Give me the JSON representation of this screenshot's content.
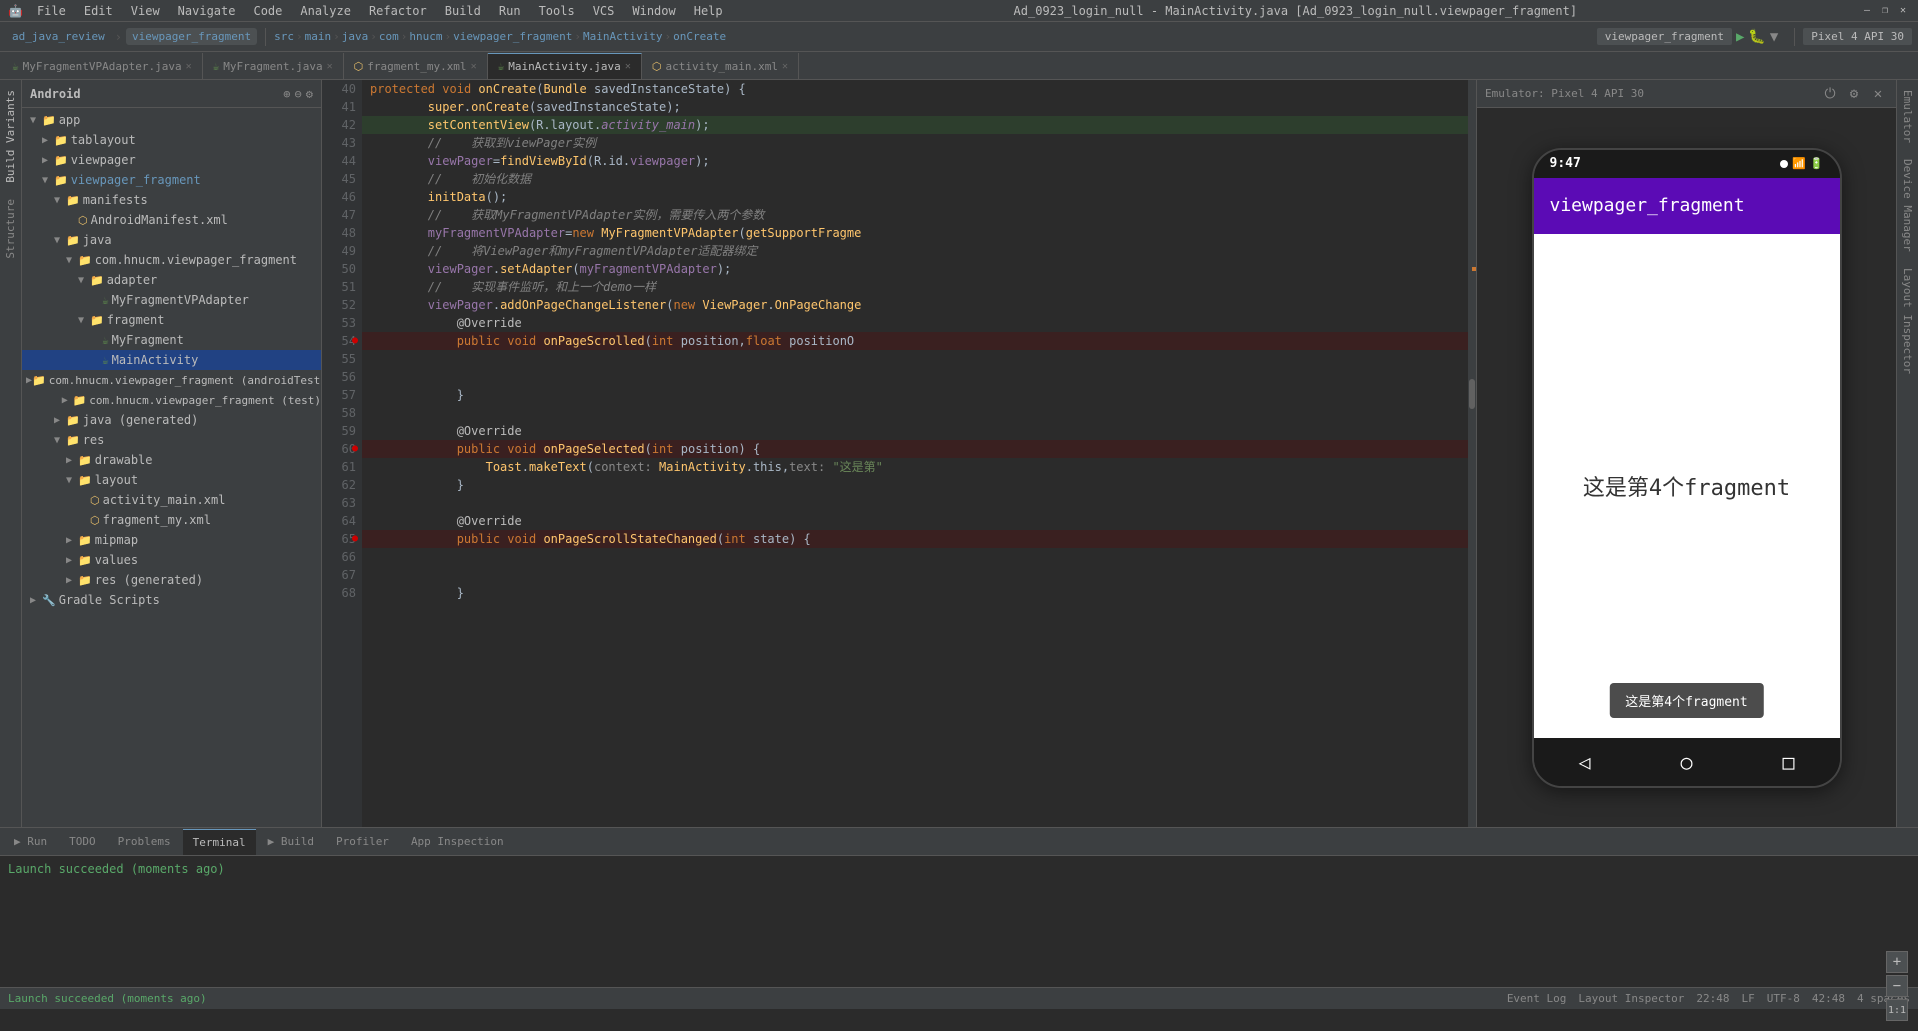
{
  "window": {
    "title": "Ad_0923_login_null - MainActivity.java [Ad_0923_login_null.viewpager_fragment]",
    "controls": [
      "—",
      "❐",
      "✕"
    ]
  },
  "menu": {
    "items": [
      "File",
      "Edit",
      "View",
      "Navigate",
      "Code",
      "Analyze",
      "Refactor",
      "Build",
      "Run",
      "Tools",
      "VCS",
      "Window",
      "Help"
    ]
  },
  "toolbar": {
    "project_name": "ad_java_review",
    "module": "viewpager_fragment",
    "src_path": "src > main > java > com > hnucm > viewpager_fragment",
    "breadcrumb": [
      "MainActivity",
      "onCreate"
    ],
    "run_config": "viewpager_fragment",
    "device": "Pixel 4 API 30"
  },
  "file_tabs": [
    {
      "name": "MyFragmentVPAdapter.java",
      "active": false
    },
    {
      "name": "MyFragment.java",
      "active": false
    },
    {
      "name": "fragment_my.xml",
      "active": false
    },
    {
      "name": "MainActivity.java",
      "active": true
    },
    {
      "name": "activity_main.xml",
      "active": false
    }
  ],
  "sidebar": {
    "title": "Android",
    "items": [
      {
        "level": 0,
        "type": "folder",
        "name": "app",
        "expanded": true
      },
      {
        "level": 1,
        "type": "folder",
        "name": "tablayout",
        "expanded": false
      },
      {
        "level": 1,
        "type": "folder",
        "name": "viewpager",
        "expanded": false
      },
      {
        "level": 1,
        "type": "folder",
        "name": "viewpager_fragment",
        "expanded": true,
        "highlighted": true
      },
      {
        "level": 2,
        "type": "folder",
        "name": "manifests",
        "expanded": true
      },
      {
        "level": 3,
        "type": "xml",
        "name": "AndroidManifest.xml"
      },
      {
        "level": 2,
        "type": "folder",
        "name": "java",
        "expanded": true
      },
      {
        "level": 3,
        "type": "folder",
        "name": "com.hnucm.viewpager_fragment",
        "expanded": true
      },
      {
        "level": 4,
        "type": "folder",
        "name": "adapter",
        "expanded": true
      },
      {
        "level": 5,
        "type": "java",
        "name": "MyFragmentVPAdapter"
      },
      {
        "level": 4,
        "type": "folder",
        "name": "fragment",
        "expanded": true
      },
      {
        "level": 5,
        "type": "java",
        "name": "MyFragment"
      },
      {
        "level": 5,
        "type": "java",
        "name": "MainActivity",
        "selected": true
      },
      {
        "level": 3,
        "type": "folder",
        "name": "com.hnucm.viewpager_fragment (androidTest)",
        "expanded": false
      },
      {
        "level": 3,
        "type": "folder",
        "name": "com.hnucm.viewpager_fragment (test)",
        "expanded": false
      },
      {
        "level": 2,
        "type": "folder",
        "name": "java (generated)",
        "expanded": false
      },
      {
        "level": 2,
        "type": "folder",
        "name": "res",
        "expanded": true
      },
      {
        "level": 3,
        "type": "folder",
        "name": "drawable",
        "expanded": false
      },
      {
        "level": 3,
        "type": "folder",
        "name": "layout",
        "expanded": true
      },
      {
        "level": 4,
        "type": "xml",
        "name": "activity_main.xml"
      },
      {
        "level": 4,
        "type": "xml",
        "name": "fragment_my.xml"
      },
      {
        "level": 3,
        "type": "folder",
        "name": "mipmap",
        "expanded": false
      },
      {
        "level": 3,
        "type": "folder",
        "name": "values",
        "expanded": false
      },
      {
        "level": 3,
        "type": "folder",
        "name": "res (generated)",
        "expanded": false
      },
      {
        "level": 0,
        "type": "folder",
        "name": "Gradle Scripts",
        "expanded": false
      }
    ]
  },
  "code": {
    "lines": [
      {
        "num": 40,
        "content": "    protected void onCreate(Bundle savedInstanceState) {",
        "type": "code"
      },
      {
        "num": 41,
        "content": "        super.onCreate(savedInstanceState);",
        "type": "code"
      },
      {
        "num": 42,
        "content": "        setContentView(R.layout.activity_main);",
        "type": "code",
        "highlighted": true
      },
      {
        "num": 43,
        "content": "        //    获取到viewPager实例",
        "type": "comment"
      },
      {
        "num": 44,
        "content": "        viewPager=findViewById(R.id.viewpager);",
        "type": "code"
      },
      {
        "num": 45,
        "content": "        //    初始化数据",
        "type": "comment"
      },
      {
        "num": 46,
        "content": "        initData();",
        "type": "code"
      },
      {
        "num": 47,
        "content": "        //    获取MyFragmentVPAdapter实例，需要传入两个参数",
        "type": "comment"
      },
      {
        "num": 48,
        "content": "        myFragmentVPAdapter=new MyFragmentVPAdapter(getSupportFragme",
        "type": "code"
      },
      {
        "num": 49,
        "content": "        //    将ViewPager和myFragmentVPAdapter适配器绑定",
        "type": "comment"
      },
      {
        "num": 50,
        "content": "        viewPager.setAdapter(myFragmentVPAdapter);",
        "type": "code"
      },
      {
        "num": 51,
        "content": "        //    实现事件监听，和上一个demo一样",
        "type": "comment"
      },
      {
        "num": 52,
        "content": "        viewPager.addOnPageChangeListener(new ViewPager.OnPageChange",
        "type": "code"
      },
      {
        "num": 53,
        "content": "            @Override",
        "type": "code"
      },
      {
        "num": 54,
        "content": "            public void onPageScrolled(int position, float positionO",
        "type": "code",
        "breakpoint": true
      },
      {
        "num": 55,
        "content": "",
        "type": "empty"
      },
      {
        "num": 56,
        "content": "",
        "type": "empty"
      },
      {
        "num": 57,
        "content": "            }",
        "type": "code"
      },
      {
        "num": 58,
        "content": "",
        "type": "empty"
      },
      {
        "num": 59,
        "content": "            @Override",
        "type": "code"
      },
      {
        "num": 60,
        "content": "            public void onPageSelected(int position) {",
        "type": "code",
        "breakpoint": true
      },
      {
        "num": 61,
        "content": "                Toast.makeText( context: MainActivity.this, text: \"这是第\"",
        "type": "code"
      },
      {
        "num": 62,
        "content": "            }",
        "type": "code"
      },
      {
        "num": 63,
        "content": "",
        "type": "empty"
      },
      {
        "num": 64,
        "content": "            @Override",
        "type": "code"
      },
      {
        "num": 65,
        "content": "            public void onPageScrollStateChanged(int state) {",
        "type": "code",
        "breakpoint": true
      },
      {
        "num": 66,
        "content": "",
        "type": "empty"
      },
      {
        "num": 67,
        "content": "",
        "type": "empty"
      },
      {
        "num": 68,
        "content": "            }",
        "type": "code"
      }
    ]
  },
  "emulator": {
    "title": "Emulator: Pixel 4 API 30",
    "phone": {
      "time": "9:47",
      "app_title": "viewpager_fragment",
      "fragment_text": "这是第4个fragment",
      "toast_text": "这是第4个fragment"
    }
  },
  "bottom_tabs": [
    "Run",
    "TODO",
    "Problems",
    "Terminal",
    "Build",
    "Profiler",
    "App Inspection"
  ],
  "build_output": "Launch succeeded (moments ago)",
  "status_bar": {
    "launch_message": "Launch succeeded (moments ago)",
    "time": "22:48",
    "encoding": "LF",
    "charset": "UTF-8",
    "position": "42:48",
    "spaces": "4 spaces"
  },
  "side_tabs_left": [
    "Build",
    "Structure"
  ],
  "side_tabs_right": [
    "Emulator",
    "Device Manager",
    "Layout Inspector"
  ],
  "layout_inspector_label": "Layout Inspector"
}
